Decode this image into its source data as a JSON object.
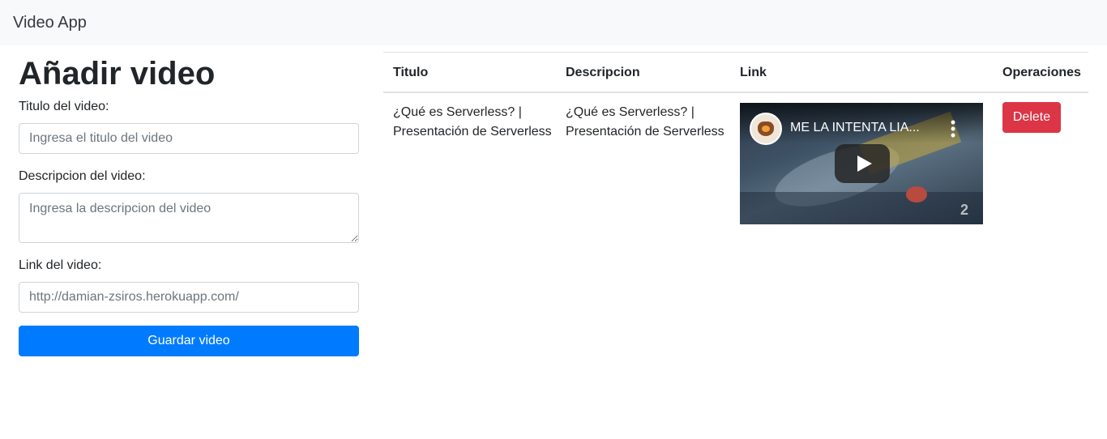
{
  "navbar": {
    "brand": "Video App"
  },
  "form": {
    "title": "Añadir video",
    "title_label": "Titulo del video:",
    "title_placeholder": "Ingresa el titulo del video",
    "description_label": "Descripcion del video:",
    "description_placeholder": "Ingresa la descripcion del video",
    "link_label": "Link del video:",
    "link_placeholder": "http://damian-zsiros.herokuapp.com/",
    "save_label": "Guardar video"
  },
  "table": {
    "headers": [
      "Titulo",
      "Descripcion",
      "Link",
      "Operaciones"
    ],
    "rows": [
      {
        "titulo": "¿Qué es Serverless? | Presentación de Serverless",
        "descripcion": "¿Qué es Serverless? | Presentación de Serverless",
        "video_title": "ME LA INTENTA LIA...",
        "delete_label": "Delete"
      }
    ]
  },
  "icons": {
    "play": "play-icon",
    "more": "more-vertical-icon"
  },
  "colors": {
    "primary": "#007bff",
    "danger": "#dc3545",
    "navbar_bg": "#f8f9fa"
  }
}
